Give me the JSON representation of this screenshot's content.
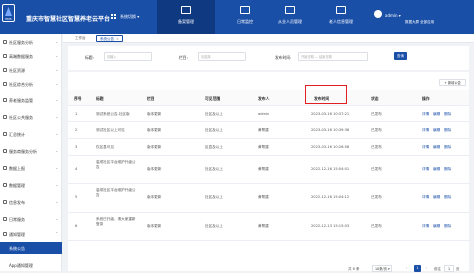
{
  "header": {
    "logo_sub": "PMS",
    "title": "重庆市智慧社区智慧养老云平台",
    "system_switch": "系统切换 ▾",
    "nav": [
      {
        "label": "备案管理"
      },
      {
        "label": "日常监控"
      },
      {
        "label": "从业人员管理"
      },
      {
        "label": "老人信息管理"
      }
    ],
    "user": "admin ▾",
    "top_links": "数据大屏  全部应用"
  },
  "sidebar": {
    "items": [
      {
        "label": "社区服务分析"
      },
      {
        "label": "高端数据服务"
      },
      {
        "label": "社区资源"
      },
      {
        "label": "社区综合分析"
      },
      {
        "label": "养老服务监管"
      },
      {
        "label": "社区公共服务"
      },
      {
        "label": "汇总统计"
      },
      {
        "label": "服务商服务分析"
      },
      {
        "label": "数据上报"
      },
      {
        "label": "数据管理"
      },
      {
        "label": "信息发布"
      },
      {
        "label": "日常服务"
      },
      {
        "label": "通知管理"
      },
      {
        "label": "系统公告"
      },
      {
        "label": "App通知管理"
      }
    ]
  },
  "tabs": [
    {
      "label": "工作台"
    },
    {
      "label": "系统公告",
      "close": "×"
    }
  ],
  "filter": {
    "title_label": "标题:",
    "title_placeholder": "请输入",
    "column_label": "栏目:",
    "column_placeholder": "请选择",
    "date_label": "发布时间:",
    "date_placeholder": "开始日期   —   结束日期",
    "search_button": "查询"
  },
  "table": {
    "add_button": "+ 新增公告",
    "columns": [
      "序号",
      "标题",
      "栏目",
      "可见范围",
      "发布人",
      "发布时间",
      "状态",
      "操作"
    ],
    "rows": [
      {
        "no": "1",
        "title": "测试系统公告-社区版",
        "column": "版本更新",
        "scope": "社区及以上",
        "author": "admin",
        "time": "2023-03-16 10:37:21",
        "status": "已发布",
        "ops": [
          "详情",
          "编辑",
          "删除"
        ]
      },
      {
        "no": "2",
        "title": "测试社区以上可见",
        "column": "版本更新",
        "scope": "社区及以上",
        "author": "黄帮建",
        "time": "2023-03-16 10:39:36",
        "status": "已发布",
        "ops": [
          "详情",
          "编辑",
          "删除"
        ]
      },
      {
        "no": "3",
        "title": "仅区县可见",
        "column": "版本更新",
        "scope": "区县及以上",
        "author": "黄帮建",
        "time": "2023-03-16 10:26:58",
        "status": "已发布",
        "ops": [
          "详情",
          "编辑",
          "删除"
        ]
      },
      {
        "no": "4",
        "title": "滥坝社区平台维护升级公告",
        "column": "版本更新",
        "scope": "社区及以上",
        "author": "黄帮建",
        "time": "2022-12-16 15:04:01",
        "status": "已发布",
        "ops": [
          "详情",
          "编辑",
          "删除"
        ]
      },
      {
        "no": "5",
        "title": "滥坝社区平台维护升级公告",
        "column": "版本更新",
        "scope": "社区及以上",
        "author": "黄帮建",
        "time": "2022-12-16 15:04:12",
        "status": "已发布",
        "ops": [
          "详情",
          "编辑",
          "删除"
        ]
      },
      {
        "no": "6",
        "title": "系统已升级，请大家重新登录",
        "column": "版本更新",
        "scope": "社区及以上",
        "author": "黄帮建",
        "time": "2022-12-13 15:15:03",
        "status": "已发布",
        "ops": [
          "详情",
          "编辑",
          "删除"
        ]
      }
    ]
  },
  "pager": {
    "total": "共 6 条",
    "page_size": "10条/页 ▾",
    "prev": "‹",
    "current": "1",
    "next": "›",
    "goto": "前往",
    "goto_value": "1",
    "unit": "页"
  }
}
